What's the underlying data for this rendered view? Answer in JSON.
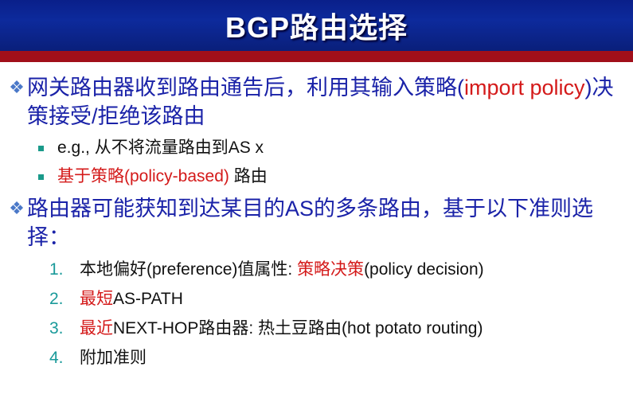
{
  "title": "BGP路由选择",
  "bullets": [
    {
      "l1_part1": "网关路由器收到路由通告后，利用其输入策略(",
      "l1_part2": "import policy",
      "l1_part3": ")决策接受/拒绝该路由",
      "subs": [
        {
          "text_plain": "e.g., 从不将流量路由到AS x"
        },
        {
          "text_red": "基于策略(policy-based)",
          "text_plain": " 路由"
        }
      ]
    },
    {
      "l1_text": "路由器可能获知到达某目的AS的多条路由，基于以下准则选择：",
      "items": [
        {
          "num": "1.",
          "text_a": "本地偏好(preference)值属性: ",
          "text_red": "策略决策",
          "text_b": "(policy decision)"
        },
        {
          "num": "2.",
          "text_red": "最短",
          "text_b": "AS-PATH"
        },
        {
          "num": "3.",
          "text_red": "最近",
          "text_b": "NEXT-HOP路由器: 热土豆路由(hot potato routing)"
        },
        {
          "num": "4.",
          "text_b": "附加准则"
        }
      ]
    }
  ],
  "colors": {
    "title_bg": "#0d2a9c",
    "title_rule": "#a10f1a",
    "text_blue": "#1a22a8",
    "text_red": "#d41a1a",
    "bullet_teal": "#1a9a8a"
  },
  "icons": {
    "l1_bullet": "diamond-bullet-icon",
    "l2_bullet": "square-bullet-icon"
  }
}
